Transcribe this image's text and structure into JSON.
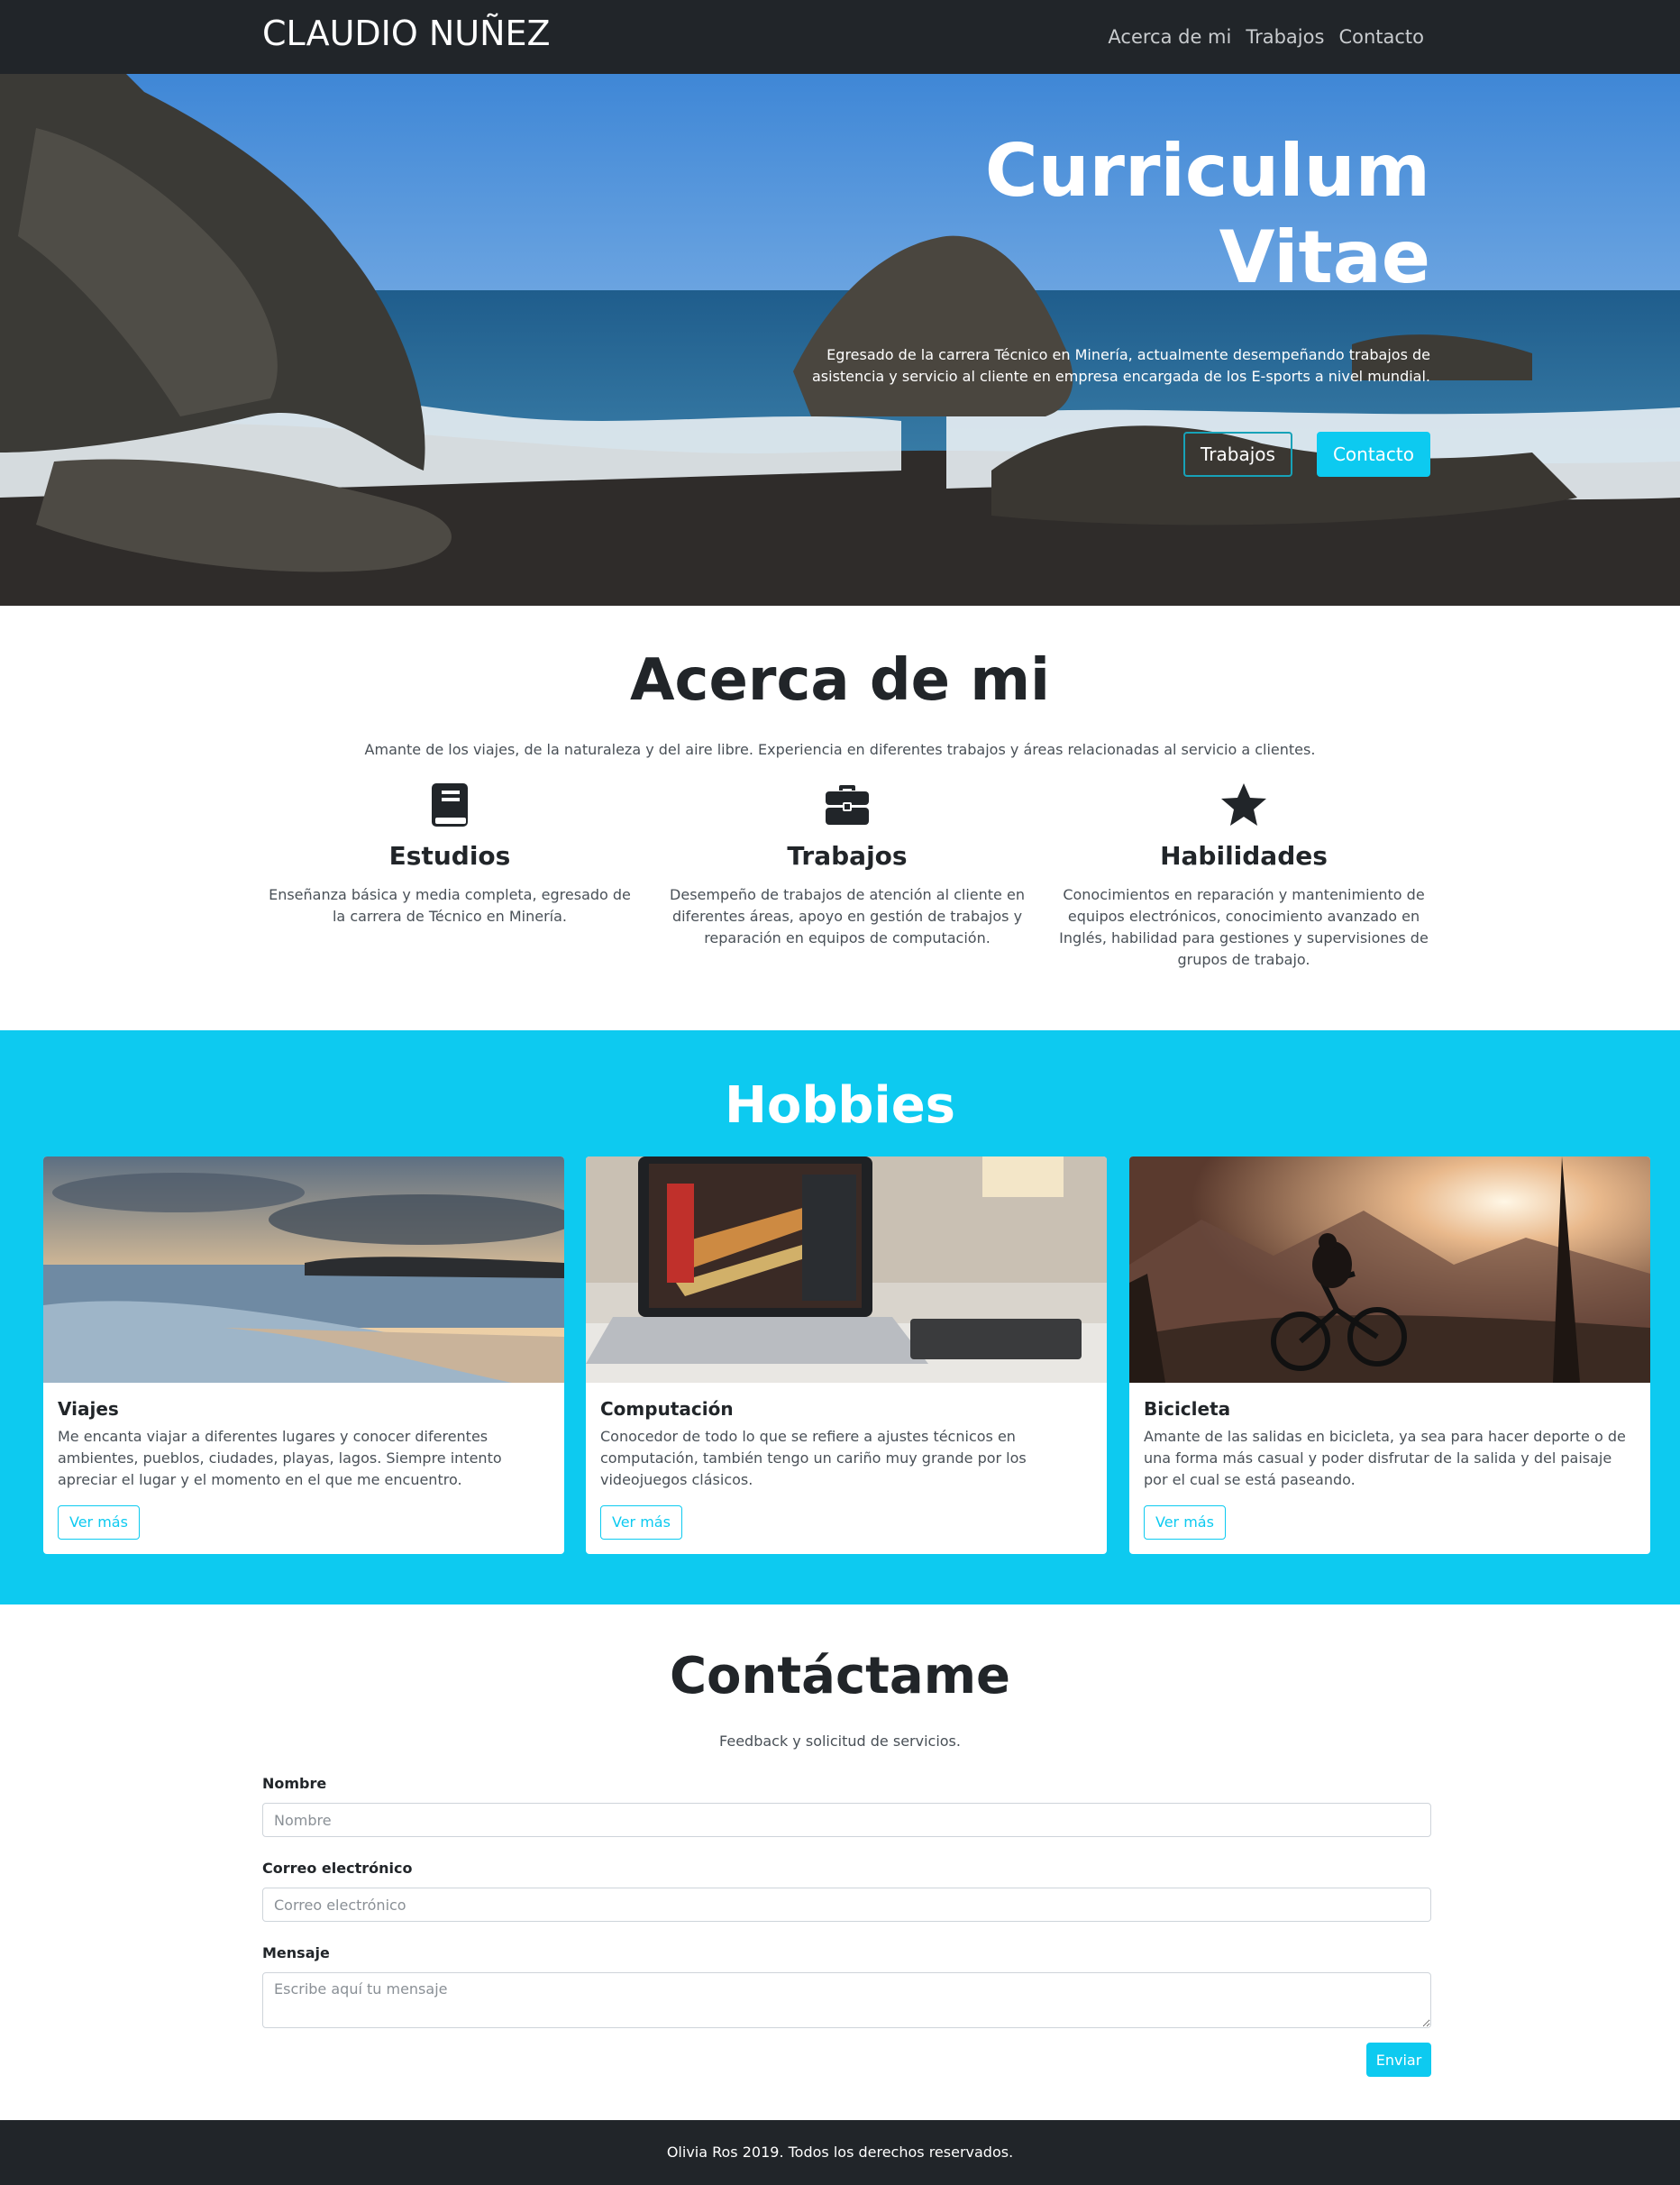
{
  "navbar": {
    "brand": "CLAUDIO NUÑEZ",
    "links": [
      "Acerca de mi",
      "Trabajos",
      "Contacto"
    ]
  },
  "hero": {
    "title_line1": "Curriculum",
    "title_line2": "Vitae",
    "description": "Egresado de la carrera Técnico en Minería, actualmente desempeñando trabajos de asistencia y servicio al cliente en empresa encargada de los E-sports a nivel mundial.",
    "button_outline": "Trabajos",
    "button_solid": "Contacto"
  },
  "about": {
    "title": "Acerca de mi",
    "subtitle": "Amante de los viajes, de la naturaleza y del aire libre. Experiencia en diferentes trabajos y áreas relacionadas al servicio a clientes.",
    "features": [
      {
        "icon": "book-icon",
        "title": "Estudios",
        "text": "Enseñanza básica y media completa, egresado de la carrera de Técnico en Minería."
      },
      {
        "icon": "briefcase-icon",
        "title": "Trabajos",
        "text": "Desempeño de trabajos de atención al cliente en diferentes áreas, apoyo en gestión de trabajos y reparación en equipos de computación."
      },
      {
        "icon": "star-icon",
        "title": "Habilidades",
        "text": "Conocimientos en reparación y mantenimiento de equipos electrónicos, conocimiento avanzado en Inglés, habilidad para gestiones y supervisiones de grupos de trabajo."
      }
    ]
  },
  "hobbies": {
    "title": "Hobbies",
    "cards": [
      {
        "title": "Viajes",
        "text": "Me encanta viajar a diferentes lugares y conocer diferentes ambientes, pueblos, ciudades, playas, lagos. Siempre intento apreciar el lugar y el momento en el que me encuentro.",
        "button": "Ver más"
      },
      {
        "title": "Computación",
        "text": "Conocedor de todo lo que se refiere a ajustes técnicos en computación, también tengo un cariño muy grande por los videojuegos clásicos.",
        "button": "Ver más"
      },
      {
        "title": "Bicicleta",
        "text": "Amante de las salidas en bicicleta, ya sea para hacer deporte o de una forma más casual y poder disfrutar de la salida y del paisaje por el cual se está paseando.",
        "button": "Ver más"
      }
    ]
  },
  "contact": {
    "title": "Contáctame",
    "subtitle": "Feedback y solicitud de servicios.",
    "name_label": "Nombre",
    "name_placeholder": "Nombre",
    "email_label": "Correo electrónico",
    "email_placeholder": "Correo electrónico",
    "message_label": "Mensaje",
    "message_placeholder": "Escribe aquí tu mensaje",
    "submit": "Enviar"
  },
  "footer": {
    "text": "Olivia Ros 2019. Todos los derechos reservados."
  },
  "colors": {
    "dark": "#212529",
    "accent": "#0dcaf0",
    "outline": "#17a2b8"
  }
}
